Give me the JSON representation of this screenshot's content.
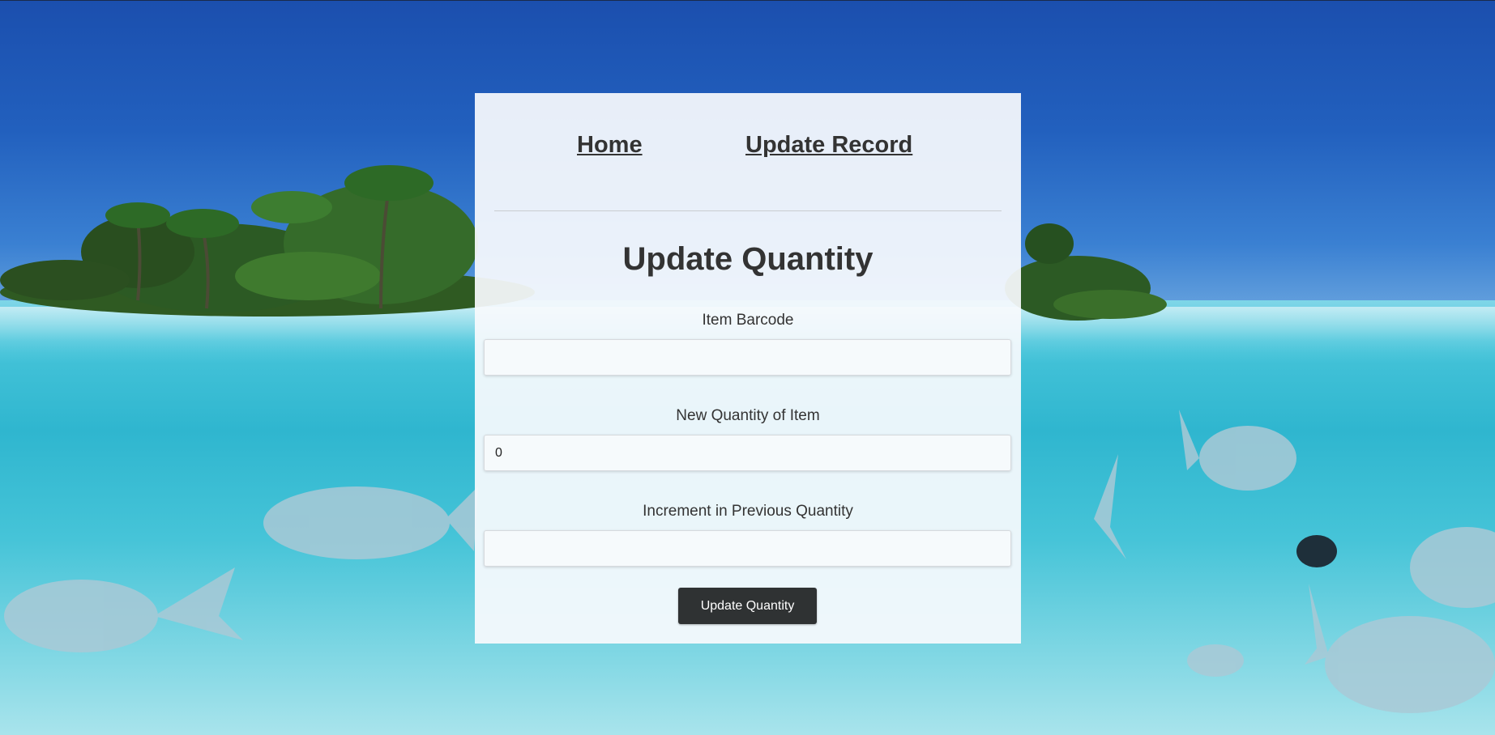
{
  "nav": {
    "home_label": "Home",
    "update_record_label": "Update Record"
  },
  "form": {
    "title": "Update Quantity",
    "barcode": {
      "label": "Item Barcode",
      "value": ""
    },
    "new_quantity": {
      "label": "New Quantity of Item",
      "value": "0"
    },
    "increment": {
      "label": "Increment in Previous Quantity",
      "value": ""
    },
    "submit_label": "Update Quantity"
  },
  "colors": {
    "sky": "#2260be",
    "water": "#2fb6cf",
    "panel": "#f8fafd",
    "text": "#333333",
    "button": "#2f3233"
  }
}
